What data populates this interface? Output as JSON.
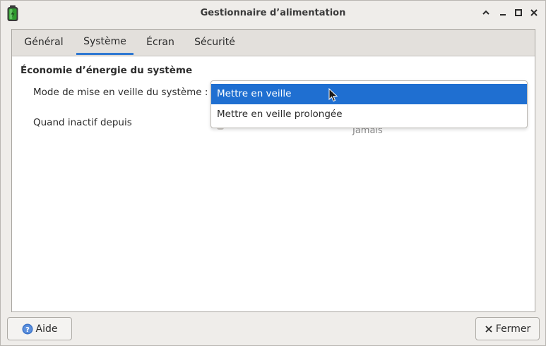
{
  "window": {
    "title": "Gestionnaire d’alimentation"
  },
  "tabs": [
    {
      "label": "Général"
    },
    {
      "label": "Système"
    },
    {
      "label": "Écran"
    },
    {
      "label": "Sécurité"
    }
  ],
  "active_tab": "Système",
  "section": {
    "title": "Économie d’énergie du système",
    "sleep_mode_label": "Mode de mise en veille du système :",
    "inactive_label": "Quand inactif depuis",
    "inactive_value": "Jamais"
  },
  "dropdown": {
    "options": [
      {
        "label": "Mettre en veille",
        "selected": true
      },
      {
        "label": "Mettre en veille prolongée",
        "selected": false
      }
    ]
  },
  "buttons": {
    "help_label": "Aide",
    "close_label": "Fermer"
  },
  "colors": {
    "accent": "#2f78d2",
    "selection": "#1f6fd1",
    "battery_icon": "#2e9a2e"
  },
  "icons": {
    "app": "battery-icon",
    "help": "help-icon",
    "close": "close-icon"
  }
}
